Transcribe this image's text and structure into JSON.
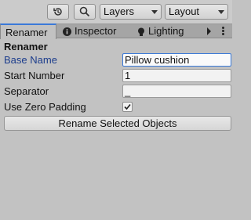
{
  "toolbar": {
    "history_icon": "history-icon",
    "search_icon": "search-icon",
    "layers_label": "Layers",
    "layout_label": "Layout"
  },
  "tabs": [
    {
      "label": "Renamer",
      "active": true
    },
    {
      "label": "Inspector",
      "icon": "info-icon"
    },
    {
      "label": "Lighting",
      "icon": "lightbulb-icon"
    }
  ],
  "renamer": {
    "title": "Renamer",
    "base_name_label": "Base Name",
    "base_name_value": "Pillow cushion",
    "start_number_label": "Start Number",
    "start_number_value": "1",
    "separator_label": "Separator",
    "separator_value": "_",
    "zero_padding_label": "Use Zero Padding",
    "zero_padding_checked": true,
    "rename_button_label": "Rename Selected Objects"
  },
  "colors": {
    "accent": "#3a79d8",
    "panel_bg": "#c2c2c2",
    "focused_label": "#1b3c8c"
  }
}
